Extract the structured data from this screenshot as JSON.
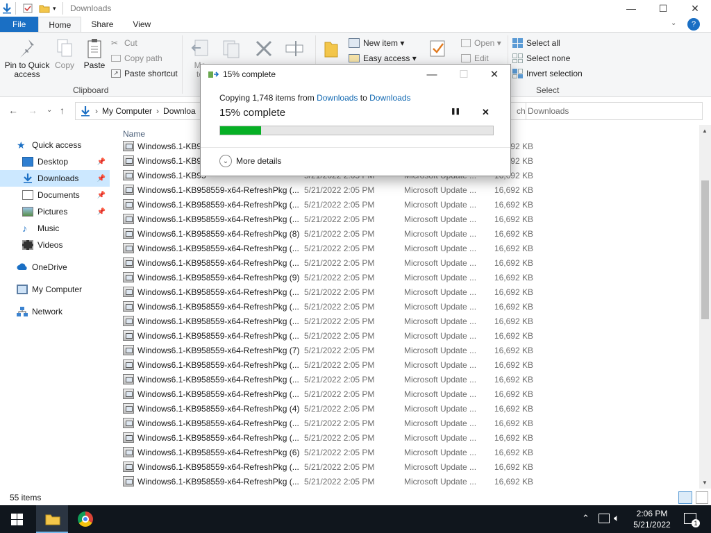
{
  "window": {
    "title": "Downloads",
    "controls": {
      "minimize": "—",
      "maximize": "☐",
      "close": "✕"
    }
  },
  "ribbon_tabs": [
    "File",
    "Home",
    "Share",
    "View"
  ],
  "ribbon": {
    "clipboard": {
      "pin_label": "Pin to Quick access",
      "copy_label": "Copy",
      "paste_label": "Paste",
      "cut_label": "Cut",
      "copy_path_label": "Copy path",
      "paste_shortcut_label": "Paste shortcut",
      "group_label": "Clipboard"
    },
    "organize": {
      "move_label": "Mo",
      "move_label2": "to"
    },
    "new": {
      "new_item_label": "New item ▾",
      "easy_access_label": "Easy access ▾"
    },
    "open": {
      "open_label": "Open ▾",
      "edit_label": "Edit"
    },
    "select": {
      "select_all_label": "Select all",
      "select_none_label": "Select none",
      "invert_label": "Invert selection",
      "group_label": "Select"
    }
  },
  "address": {
    "crumbs": [
      "My Computer",
      "Downloa"
    ],
    "search_placeholder": "ch Downloads"
  },
  "nav_pane": {
    "items": [
      {
        "label": "Quick access",
        "icon": "star-icon"
      },
      {
        "label": "Desktop",
        "icon": "desktop-icon",
        "pinned": true
      },
      {
        "label": "Downloads",
        "icon": "download-arrow-icon",
        "pinned": true,
        "selected": true
      },
      {
        "label": "Documents",
        "icon": "documents-icon",
        "pinned": true
      },
      {
        "label": "Pictures",
        "icon": "pictures-icon",
        "pinned": true
      },
      {
        "label": "Music",
        "icon": "music-icon"
      },
      {
        "label": "Videos",
        "icon": "videos-icon"
      },
      {
        "label": "OneDrive",
        "icon": "cloud-icon"
      },
      {
        "label": "My Computer",
        "icon": "computer-icon"
      },
      {
        "label": "Network",
        "icon": "network-icon"
      }
    ]
  },
  "file_list": {
    "column_name": "Name",
    "rows": [
      {
        "name": "Windows6.1-KB95",
        "date": "",
        "type": "",
        "size": "692 KB"
      },
      {
        "name": "Windows6.1-KB95",
        "date": "",
        "type": "",
        "size": "692 KB"
      },
      {
        "name": "Windows6.1-KB95",
        "date": "5/21/2022 2:05 PM",
        "type": "Microsoft Update ...",
        "size": "16,692 KB"
      },
      {
        "name": "Windows6.1-KB958559-x64-RefreshPkg (...",
        "date": "5/21/2022 2:05 PM",
        "type": "Microsoft Update ...",
        "size": "16,692 KB"
      },
      {
        "name": "Windows6.1-KB958559-x64-RefreshPkg (...",
        "date": "5/21/2022 2:05 PM",
        "type": "Microsoft Update ...",
        "size": "16,692 KB"
      },
      {
        "name": "Windows6.1-KB958559-x64-RefreshPkg (...",
        "date": "5/21/2022 2:05 PM",
        "type": "Microsoft Update ...",
        "size": "16,692 KB"
      },
      {
        "name": "Windows6.1-KB958559-x64-RefreshPkg (8)",
        "date": "5/21/2022 2:05 PM",
        "type": "Microsoft Update ...",
        "size": "16,692 KB"
      },
      {
        "name": "Windows6.1-KB958559-x64-RefreshPkg (...",
        "date": "5/21/2022 2:05 PM",
        "type": "Microsoft Update ...",
        "size": "16,692 KB"
      },
      {
        "name": "Windows6.1-KB958559-x64-RefreshPkg (...",
        "date": "5/21/2022 2:05 PM",
        "type": "Microsoft Update ...",
        "size": "16,692 KB"
      },
      {
        "name": "Windows6.1-KB958559-x64-RefreshPkg (9)",
        "date": "5/21/2022 2:05 PM",
        "type": "Microsoft Update ...",
        "size": "16,692 KB"
      },
      {
        "name": "Windows6.1-KB958559-x64-RefreshPkg (...",
        "date": "5/21/2022 2:05 PM",
        "type": "Microsoft Update ...",
        "size": "16,692 KB"
      },
      {
        "name": "Windows6.1-KB958559-x64-RefreshPkg (...",
        "date": "5/21/2022 2:05 PM",
        "type": "Microsoft Update ...",
        "size": "16,692 KB"
      },
      {
        "name": "Windows6.1-KB958559-x64-RefreshPkg (...",
        "date": "5/21/2022 2:05 PM",
        "type": "Microsoft Update ...",
        "size": "16,692 KB"
      },
      {
        "name": "Windows6.1-KB958559-x64-RefreshPkg (...",
        "date": "5/21/2022 2:05 PM",
        "type": "Microsoft Update ...",
        "size": "16,692 KB"
      },
      {
        "name": "Windows6.1-KB958559-x64-RefreshPkg (7)",
        "date": "5/21/2022 2:05 PM",
        "type": "Microsoft Update ...",
        "size": "16,692 KB"
      },
      {
        "name": "Windows6.1-KB958559-x64-RefreshPkg (...",
        "date": "5/21/2022 2:05 PM",
        "type": "Microsoft Update ...",
        "size": "16,692 KB"
      },
      {
        "name": "Windows6.1-KB958559-x64-RefreshPkg (...",
        "date": "5/21/2022 2:05 PM",
        "type": "Microsoft Update ...",
        "size": "16,692 KB"
      },
      {
        "name": "Windows6.1-KB958559-x64-RefreshPkg (...",
        "date": "5/21/2022 2:05 PM",
        "type": "Microsoft Update ...",
        "size": "16,692 KB"
      },
      {
        "name": "Windows6.1-KB958559-x64-RefreshPkg (4)",
        "date": "5/21/2022 2:05 PM",
        "type": "Microsoft Update ...",
        "size": "16,692 KB"
      },
      {
        "name": "Windows6.1-KB958559-x64-RefreshPkg (...",
        "date": "5/21/2022 2:05 PM",
        "type": "Microsoft Update ...",
        "size": "16,692 KB"
      },
      {
        "name": "Windows6.1-KB958559-x64-RefreshPkg (...",
        "date": "5/21/2022 2:05 PM",
        "type": "Microsoft Update ...",
        "size": "16,692 KB"
      },
      {
        "name": "Windows6.1-KB958559-x64-RefreshPkg (6)",
        "date": "5/21/2022 2:05 PM",
        "type": "Microsoft Update ...",
        "size": "16,692 KB"
      },
      {
        "name": "Windows6.1-KB958559-x64-RefreshPkg (...",
        "date": "5/21/2022 2:05 PM",
        "type": "Microsoft Update ...",
        "size": "16,692 KB"
      },
      {
        "name": "Windows6.1-KB958559-x64-RefreshPkg (...",
        "date": "5/21/2022 2:05 PM",
        "type": "Microsoft Update ...",
        "size": "16,692 KB"
      }
    ]
  },
  "status_bar": {
    "item_count": "55 items"
  },
  "copy_dialog": {
    "title": "15% complete",
    "desc_prefix": "Copying 1,748 items from ",
    "source": "Downloads",
    "desc_mid": " to ",
    "dest": "Downloads",
    "progress_text": "15% complete",
    "progress_fraction": 0.15,
    "pause_symbol": "❚❚",
    "cancel_symbol": "✕",
    "more_details_label": "More details",
    "progress_color": "#06b025",
    "link_color": "#0f67b1"
  },
  "taskbar": {
    "time": "2:06 PM",
    "date": "5/21/2022",
    "notification_count": "1"
  }
}
